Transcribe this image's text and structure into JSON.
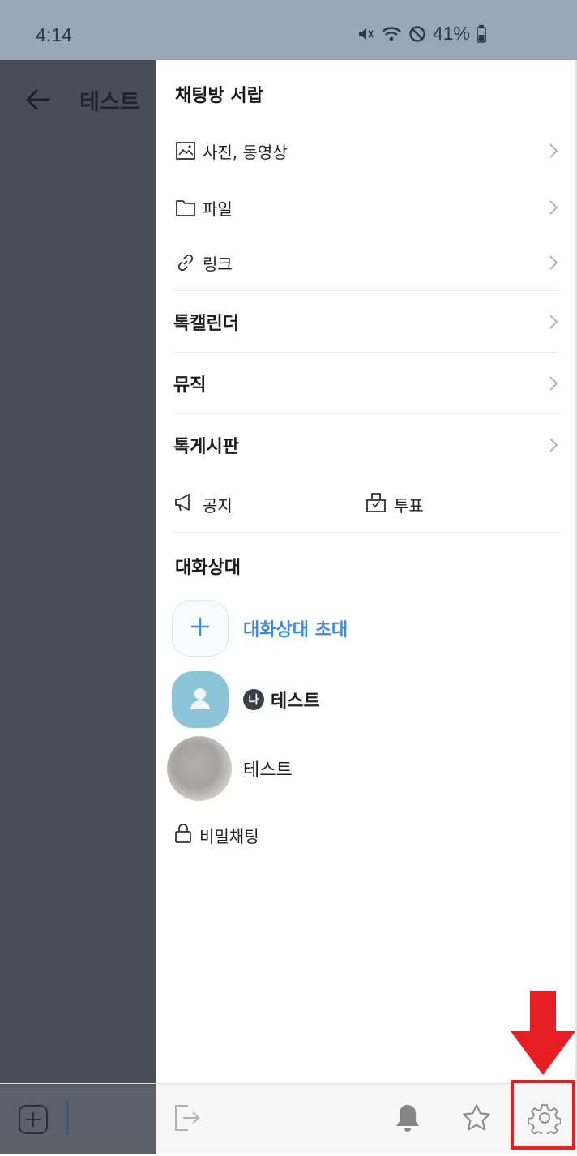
{
  "status_bar": {
    "time": "4:14",
    "battery": "41%",
    "icons": [
      "mute-icon",
      "wifi-icon",
      "do-not-disturb-icon",
      "battery-icon"
    ]
  },
  "chat_background": {
    "title": "테스트"
  },
  "drawer": {
    "section_drawer_title": "채팅방 서랍",
    "drawer_items": [
      {
        "label": "사진, 동영상",
        "icon": "photo-icon"
      },
      {
        "label": "파일",
        "icon": "folder-icon"
      },
      {
        "label": "링크",
        "icon": "link-icon"
      }
    ],
    "menu_items": [
      {
        "label": "톡캘린더"
      },
      {
        "label": "뮤직"
      },
      {
        "label": "톡게시판"
      }
    ],
    "notice_label": "공지",
    "vote_label": "투표",
    "members_title": "대화상대",
    "invite_label": "대화상대 초대",
    "members": [
      {
        "name": "테스트",
        "badge": "나"
      },
      {
        "name": "테스트"
      }
    ],
    "secret_chat_label": "비밀채팅"
  },
  "bottom_bar": {
    "icons": [
      "plus-icon",
      "exit-icon",
      "bell-icon",
      "star-icon",
      "gear-icon"
    ]
  },
  "annotation": {
    "color": "#e81e25"
  }
}
